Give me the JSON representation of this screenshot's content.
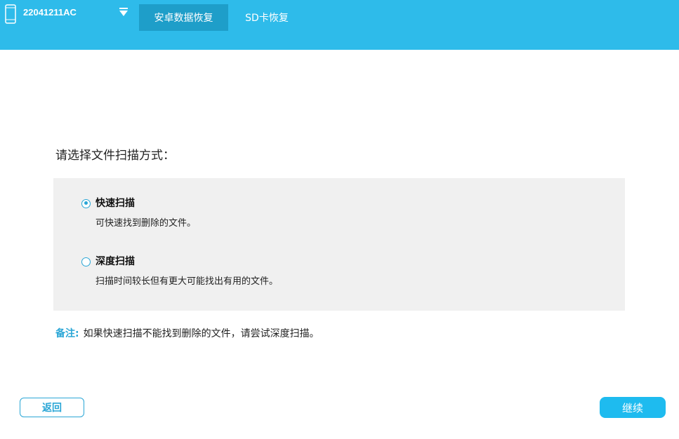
{
  "header": {
    "device_name": "22041211AC",
    "device_icon": "phone-icon",
    "dropdown_icon": "triangle-down-icon",
    "tabs": [
      {
        "label": "安卓数据恢复",
        "active": true
      },
      {
        "label": "SD卡恢复",
        "active": false
      }
    ]
  },
  "scan": {
    "prompt": "请选择文件扫描方式：",
    "options": [
      {
        "title": "快速扫描",
        "description": "可快速找到删除的文件。",
        "selected": true
      },
      {
        "title": "深度扫描",
        "description": "扫描时间较长但有更大可能找出有用的文件。",
        "selected": false
      }
    ],
    "note_label": "备注:",
    "note_text": "如果快速扫描不能找到删除的文件，请尝试深度扫描。"
  },
  "footer": {
    "back_label": "返回",
    "continue_label": "继续"
  },
  "colors": {
    "header_bg": "#2ebbea",
    "active_tab_bg": "#1e9ec9",
    "accent": "#2aa6d6",
    "panel_bg": "#f0f0f0",
    "continue_bg": "#1ebbef"
  }
}
